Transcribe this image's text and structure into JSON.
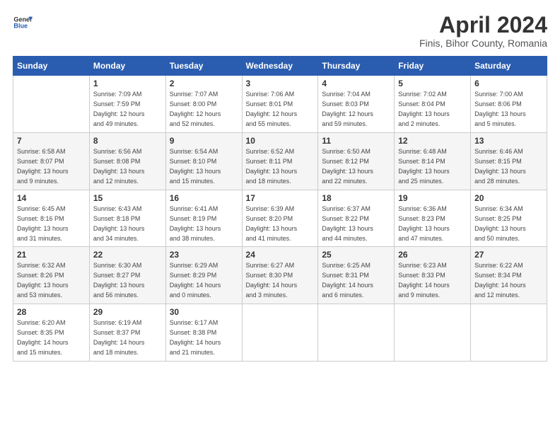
{
  "logo": {
    "line1": "General",
    "line2": "Blue"
  },
  "title": "April 2024",
  "subtitle": "Finis, Bihor County, Romania",
  "weekdays": [
    "Sunday",
    "Monday",
    "Tuesday",
    "Wednesday",
    "Thursday",
    "Friday",
    "Saturday"
  ],
  "weeks": [
    [
      {
        "day": "",
        "info": ""
      },
      {
        "day": "1",
        "info": "Sunrise: 7:09 AM\nSunset: 7:59 PM\nDaylight: 12 hours\nand 49 minutes."
      },
      {
        "day": "2",
        "info": "Sunrise: 7:07 AM\nSunset: 8:00 PM\nDaylight: 12 hours\nand 52 minutes."
      },
      {
        "day": "3",
        "info": "Sunrise: 7:06 AM\nSunset: 8:01 PM\nDaylight: 12 hours\nand 55 minutes."
      },
      {
        "day": "4",
        "info": "Sunrise: 7:04 AM\nSunset: 8:03 PM\nDaylight: 12 hours\nand 59 minutes."
      },
      {
        "day": "5",
        "info": "Sunrise: 7:02 AM\nSunset: 8:04 PM\nDaylight: 13 hours\nand 2 minutes."
      },
      {
        "day": "6",
        "info": "Sunrise: 7:00 AM\nSunset: 8:06 PM\nDaylight: 13 hours\nand 5 minutes."
      }
    ],
    [
      {
        "day": "7",
        "info": "Sunrise: 6:58 AM\nSunset: 8:07 PM\nDaylight: 13 hours\nand 9 minutes."
      },
      {
        "day": "8",
        "info": "Sunrise: 6:56 AM\nSunset: 8:08 PM\nDaylight: 13 hours\nand 12 minutes."
      },
      {
        "day": "9",
        "info": "Sunrise: 6:54 AM\nSunset: 8:10 PM\nDaylight: 13 hours\nand 15 minutes."
      },
      {
        "day": "10",
        "info": "Sunrise: 6:52 AM\nSunset: 8:11 PM\nDaylight: 13 hours\nand 18 minutes."
      },
      {
        "day": "11",
        "info": "Sunrise: 6:50 AM\nSunset: 8:12 PM\nDaylight: 13 hours\nand 22 minutes."
      },
      {
        "day": "12",
        "info": "Sunrise: 6:48 AM\nSunset: 8:14 PM\nDaylight: 13 hours\nand 25 minutes."
      },
      {
        "day": "13",
        "info": "Sunrise: 6:46 AM\nSunset: 8:15 PM\nDaylight: 13 hours\nand 28 minutes."
      }
    ],
    [
      {
        "day": "14",
        "info": "Sunrise: 6:45 AM\nSunset: 8:16 PM\nDaylight: 13 hours\nand 31 minutes."
      },
      {
        "day": "15",
        "info": "Sunrise: 6:43 AM\nSunset: 8:18 PM\nDaylight: 13 hours\nand 34 minutes."
      },
      {
        "day": "16",
        "info": "Sunrise: 6:41 AM\nSunset: 8:19 PM\nDaylight: 13 hours\nand 38 minutes."
      },
      {
        "day": "17",
        "info": "Sunrise: 6:39 AM\nSunset: 8:20 PM\nDaylight: 13 hours\nand 41 minutes."
      },
      {
        "day": "18",
        "info": "Sunrise: 6:37 AM\nSunset: 8:22 PM\nDaylight: 13 hours\nand 44 minutes."
      },
      {
        "day": "19",
        "info": "Sunrise: 6:36 AM\nSunset: 8:23 PM\nDaylight: 13 hours\nand 47 minutes."
      },
      {
        "day": "20",
        "info": "Sunrise: 6:34 AM\nSunset: 8:25 PM\nDaylight: 13 hours\nand 50 minutes."
      }
    ],
    [
      {
        "day": "21",
        "info": "Sunrise: 6:32 AM\nSunset: 8:26 PM\nDaylight: 13 hours\nand 53 minutes."
      },
      {
        "day": "22",
        "info": "Sunrise: 6:30 AM\nSunset: 8:27 PM\nDaylight: 13 hours\nand 56 minutes."
      },
      {
        "day": "23",
        "info": "Sunrise: 6:29 AM\nSunset: 8:29 PM\nDaylight: 14 hours\nand 0 minutes."
      },
      {
        "day": "24",
        "info": "Sunrise: 6:27 AM\nSunset: 8:30 PM\nDaylight: 14 hours\nand 3 minutes."
      },
      {
        "day": "25",
        "info": "Sunrise: 6:25 AM\nSunset: 8:31 PM\nDaylight: 14 hours\nand 6 minutes."
      },
      {
        "day": "26",
        "info": "Sunrise: 6:23 AM\nSunset: 8:33 PM\nDaylight: 14 hours\nand 9 minutes."
      },
      {
        "day": "27",
        "info": "Sunrise: 6:22 AM\nSunset: 8:34 PM\nDaylight: 14 hours\nand 12 minutes."
      }
    ],
    [
      {
        "day": "28",
        "info": "Sunrise: 6:20 AM\nSunset: 8:35 PM\nDaylight: 14 hours\nand 15 minutes."
      },
      {
        "day": "29",
        "info": "Sunrise: 6:19 AM\nSunset: 8:37 PM\nDaylight: 14 hours\nand 18 minutes."
      },
      {
        "day": "30",
        "info": "Sunrise: 6:17 AM\nSunset: 8:38 PM\nDaylight: 14 hours\nand 21 minutes."
      },
      {
        "day": "",
        "info": ""
      },
      {
        "day": "",
        "info": ""
      },
      {
        "day": "",
        "info": ""
      },
      {
        "day": "",
        "info": ""
      }
    ]
  ]
}
